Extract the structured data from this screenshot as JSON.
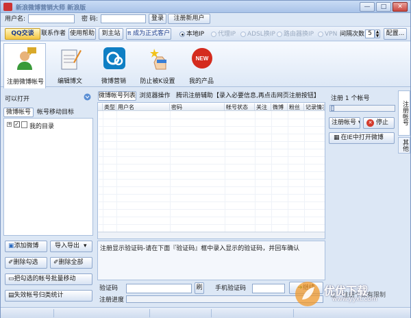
{
  "window": {
    "title": "新浪微博营销大师 新浪版",
    "min": "—",
    "max": "□",
    "close": "✕"
  },
  "login": {
    "username_label": "用户名:",
    "password_label": "密  码:",
    "login_btn": "登录",
    "register_btn": "注册新用户"
  },
  "toolbar": {
    "qq_btn": "QQ交谈",
    "contact_author": "联系作者",
    "help_btn": "使用帮助",
    "website_btn": "到主站",
    "vip_btn": "π 成为正式客户",
    "radio_local": "本地IP",
    "radio_proxy": "代理IP",
    "radio_adsl": "ADSL换IP",
    "radio_router": "路由器换IP",
    "radio_vpn": "VPN",
    "interval_label": "间隔次数",
    "interval_value": "5",
    "config_btn": "配置..."
  },
  "ribbon": [
    {
      "label": "注册微博帐号"
    },
    {
      "label": "编辑博文"
    },
    {
      "label": "微博营销"
    },
    {
      "label": "防止被K设置"
    },
    {
      "label": "我的产品"
    }
  ],
  "left": {
    "can_open": "可以打开",
    "tab1": "微博帐号",
    "tab2": "帐号移动目标",
    "tree_root": "我的目录",
    "btn_add": "添加微博",
    "btn_import": "导入导出",
    "btn_del_checked": "删除勾选",
    "btn_del_all": "删除全部",
    "btn_batch_move": "把勾选的帐号批量移动",
    "btn_fail_stats": "失效帐号归类统计"
  },
  "center": {
    "tab1": "微博帐号列表",
    "tab2": "浏览器操作",
    "notice": "腾讯注册辅助【录入必要信息,再点击网页注册按钮】",
    "columns": [
      "类型",
      "用户名",
      "密码",
      "帐号状态",
      "关注",
      "微博",
      "粉丝",
      "记录情况"
    ],
    "hint": "注册显示验证码-请在下面『验证码』框中录入显示的验证码，并回车确认",
    "captcha_label": "验证码",
    "refresh_btn": "刷",
    "phone_captcha_label": "手机验证码",
    "continue_btn": "继续",
    "progress_label": "注册进度"
  },
  "right": {
    "register_count": "注册 1 个帐号",
    "register_btn": "注册帐号",
    "stop_btn": "停止",
    "open_ie_btn": "在IE中打开微博",
    "bottom_text": "注一注册个数有限制",
    "vtab1": "注册帐号",
    "vtab2": "其他"
  },
  "watermark": {
    "cn": "优优下载",
    "en": "www.yyxt.com"
  },
  "colors": {
    "accent": "#2d6bbf",
    "window_bg": "#dce7f5",
    "stop_red": "#d33a2c"
  }
}
